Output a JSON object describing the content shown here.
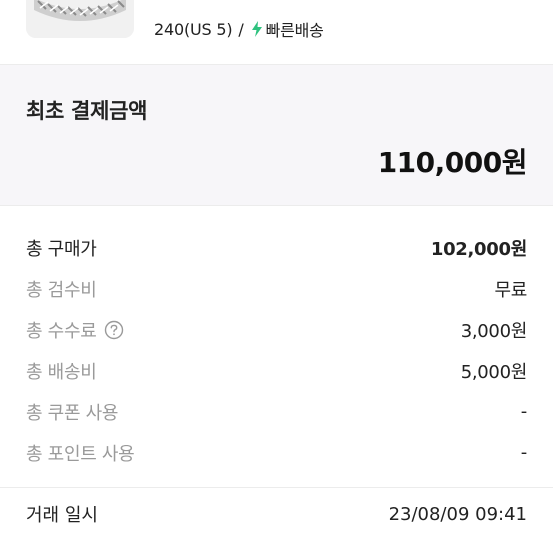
{
  "product": {
    "size_text": "240(US 5)",
    "separator": "/",
    "delivery_label": "빠른배송",
    "accent_color": "#2fc27f"
  },
  "initial_payment": {
    "label": "최초 결제금액",
    "amount": "110,000원"
  },
  "breakdown": [
    {
      "label": "총 구매가",
      "value": "102,000원"
    },
    {
      "label": "총 검수비",
      "value": "무료"
    },
    {
      "label": "총 수수료",
      "value": "3,000원"
    },
    {
      "label": "총 배송비",
      "value": "5,000원"
    },
    {
      "label": "총 쿠폰 사용",
      "value": "-"
    },
    {
      "label": "총 포인트 사용",
      "value": "-"
    }
  ],
  "transaction": {
    "label": "거래 일시",
    "value": "23/08/09 09:41"
  }
}
